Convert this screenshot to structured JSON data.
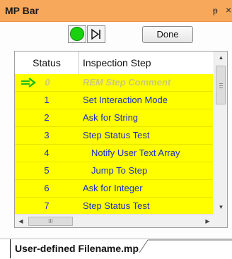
{
  "window": {
    "title": "MP Bar",
    "pin_glyph": "ᵽ",
    "close_glyph": "×"
  },
  "toolbar": {
    "run_icon": "green-circle-run",
    "step_icon": "step-into",
    "done_label": "Done",
    "run_color": "#19d10e"
  },
  "grid": {
    "columns": [
      "Status",
      "Inspection Step"
    ],
    "rows": [
      {
        "status": "0",
        "step": "REM Step Comment",
        "current": true,
        "comment": true
      },
      {
        "status": "1",
        "step": "Set Interaction Mode"
      },
      {
        "status": "2",
        "step": "Ask for String"
      },
      {
        "status": "3",
        "step": "Step Status Test"
      },
      {
        "status": "4",
        "step": "Notify User Text Array",
        "indent": true
      },
      {
        "status": "5",
        "step": "Jump To Step",
        "indent": true
      },
      {
        "status": "6",
        "step": "Ask for Integer"
      },
      {
        "status": "7",
        "step": "Step Status Test"
      }
    ],
    "row_color": "#ffff00",
    "text_color": "#1c2fc4",
    "current_arrow_color": "#1fbf12"
  },
  "hscroll": {
    "thumb_glyph": "III"
  },
  "tabs": [
    {
      "label": "User-defined Filename.mp"
    }
  ]
}
